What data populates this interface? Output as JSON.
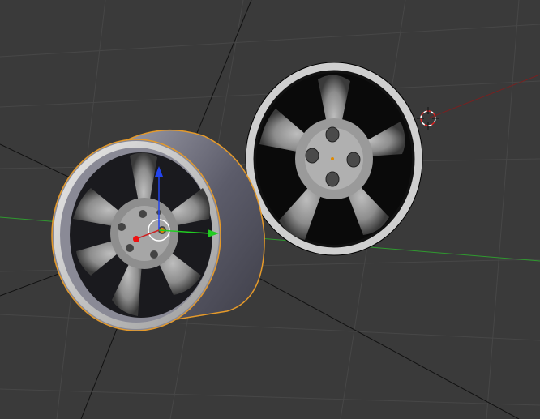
{
  "viewport": {
    "background": "#3a3a3a",
    "grid_color": "#4a4a4a",
    "x_axis_color": "#2f9a2f",
    "y_axis_color": "#7a2020",
    "selection_color": "#e59a2a"
  },
  "objects": [
    {
      "name": "wheel-selected",
      "selected": true
    },
    {
      "name": "wheel-front",
      "selected": false
    }
  ],
  "gizmo": {
    "x_color": "#22cc22",
    "y_color": "#cc2222",
    "z_color": "#2244ee"
  },
  "icons": [
    "3d-cursor-icon",
    "transform-gizmo-icon"
  ]
}
